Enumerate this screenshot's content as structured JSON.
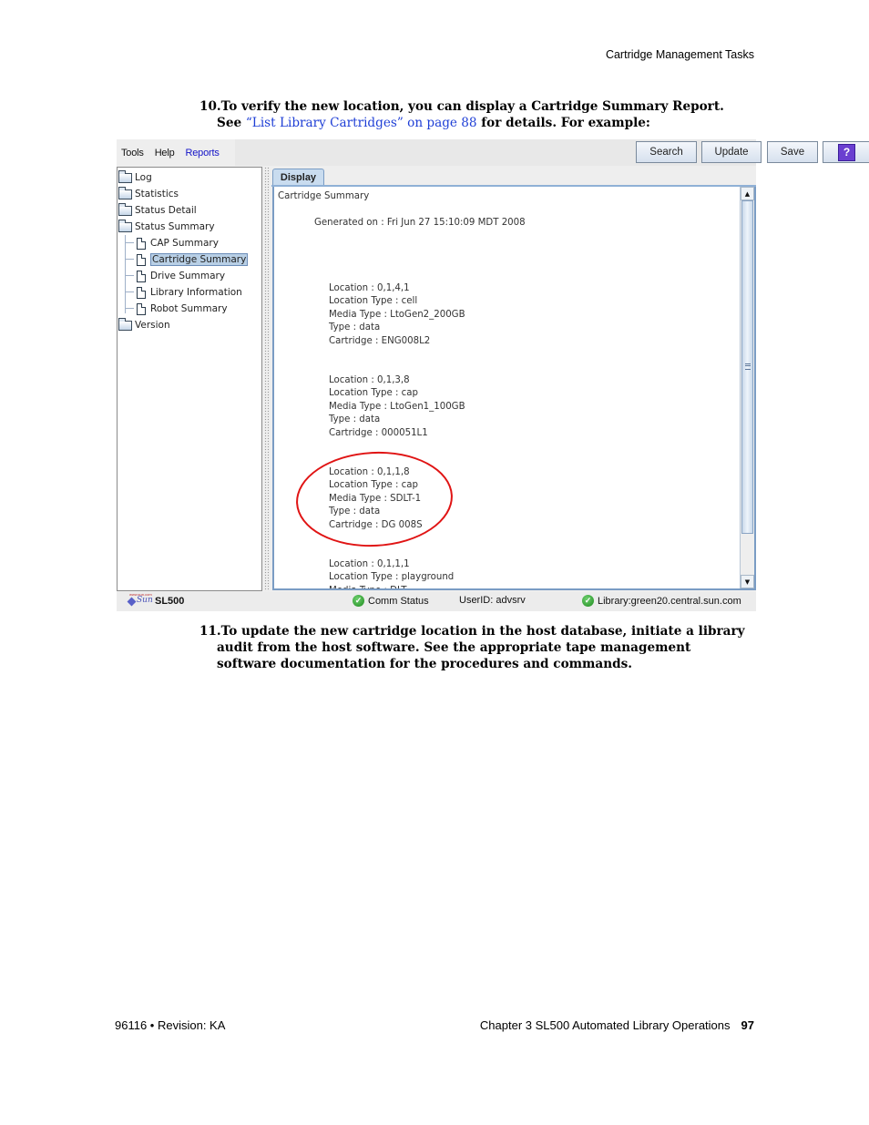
{
  "page": {
    "running_header": "Cartridge Management Tasks",
    "step10": {
      "number": "10.",
      "text_before": "To verify the new location, you can display a Cartridge Summary Report. See ",
      "link": "“List Library Cartridges” on page 88",
      "text_after": " for details. For example:"
    },
    "step11": {
      "number": "11.",
      "text": "To update the new cartridge location in the host database, initiate a library audit from the host software. See the appropriate tape management software documentation for the procedures and commands."
    },
    "footer": {
      "left": "96116 • Revision: KA",
      "chapter": "Chapter 3 SL500 Automated Library Operations",
      "page_number": "97"
    }
  },
  "app": {
    "menu": [
      "Tools",
      "Help",
      "Reports"
    ],
    "active_menu": "Reports",
    "toolbar": {
      "search": "Search",
      "update": "Update",
      "save": "Save",
      "help_icon": "help-question-icon",
      "help_glyph": "?"
    },
    "tree": {
      "items": [
        {
          "label": "Log",
          "icon": "folder-icon"
        },
        {
          "label": "Statistics",
          "icon": "folder-icon"
        },
        {
          "label": "Status Detail",
          "icon": "folder-icon"
        },
        {
          "label": "Status Summary",
          "icon": "folder-icon",
          "expanded": true
        },
        {
          "label": "CAP Summary",
          "icon": "document-icon"
        },
        {
          "label": "Cartridge Summary",
          "icon": "document-icon",
          "selected": true
        },
        {
          "label": "Drive Summary",
          "icon": "document-icon"
        },
        {
          "label": "Library Information",
          "icon": "document-icon"
        },
        {
          "label": "Robot Summary",
          "icon": "document-icon"
        },
        {
          "label": "Version",
          "icon": "folder-icon"
        }
      ]
    },
    "tab": "Display",
    "report": {
      "title": "Cartridge Summary",
      "generated": "Generated on : Fri Jun 27 15:10:09 MDT 2008",
      "records": [
        [
          "Location : 0,1,4,1",
          "Location Type : cell",
          "Media Type : LtoGen2_200GB",
          "Type : data",
          "Cartridge : ENG008L2"
        ],
        [
          "Location : 0,1,3,8",
          "Location Type : cap",
          "Media Type : LtoGen1_100GB",
          "Type : data",
          "Cartridge : 000051L1"
        ],
        [
          "Location : 0,1,1,8",
          "Location Type : cap",
          "Media Type : SDLT-1",
          "Type : data",
          "Cartridge : DG 008S"
        ],
        [
          "Location : 0,1,1,1",
          "Location Type : playground"
        ]
      ],
      "highlighted_record_index": 2
    },
    "status": {
      "product": "SL500",
      "logo": "Sun",
      "comm_status": "Comm Status",
      "user": "UserID: advsrv",
      "library": "Library:green20.central.sun.com",
      "check_glyph": "✓"
    }
  }
}
